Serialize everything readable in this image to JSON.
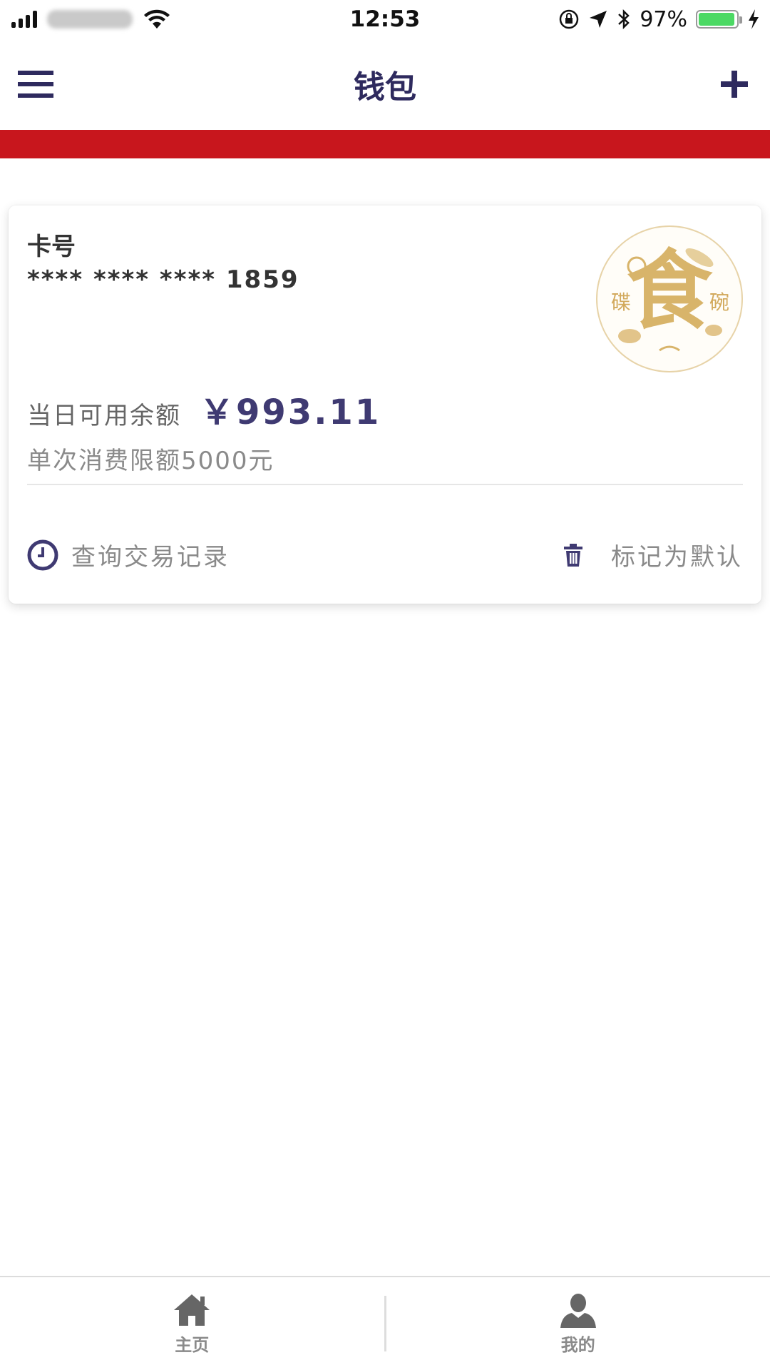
{
  "status_bar": {
    "time": "12:53",
    "battery": "97%",
    "battery_level": 0.97,
    "battery_color": "#4cd964"
  },
  "nav": {
    "title": "钱包",
    "menu_icon": "hamburger-menu-icon",
    "add_icon": "plus-icon",
    "title_color": "#2e2a5e",
    "accent_bar_color": "#c8161d"
  },
  "card": {
    "label": "卡号",
    "number": "**** **** **** 1859",
    "logo": {
      "main": "食",
      "left": "碟",
      "right": "碗"
    },
    "balance_label": "当日可用余额",
    "balance_value": "￥993.11",
    "limit": "单次消费限额5000元",
    "history_label": "查询交易记录",
    "history_icon": "clock-icon",
    "default_label": "标记为默认",
    "default_icon": "trash-icon"
  },
  "tabs": [
    {
      "label": "主页",
      "icon": "home-icon"
    },
    {
      "label": "我的",
      "icon": "user-icon"
    }
  ]
}
